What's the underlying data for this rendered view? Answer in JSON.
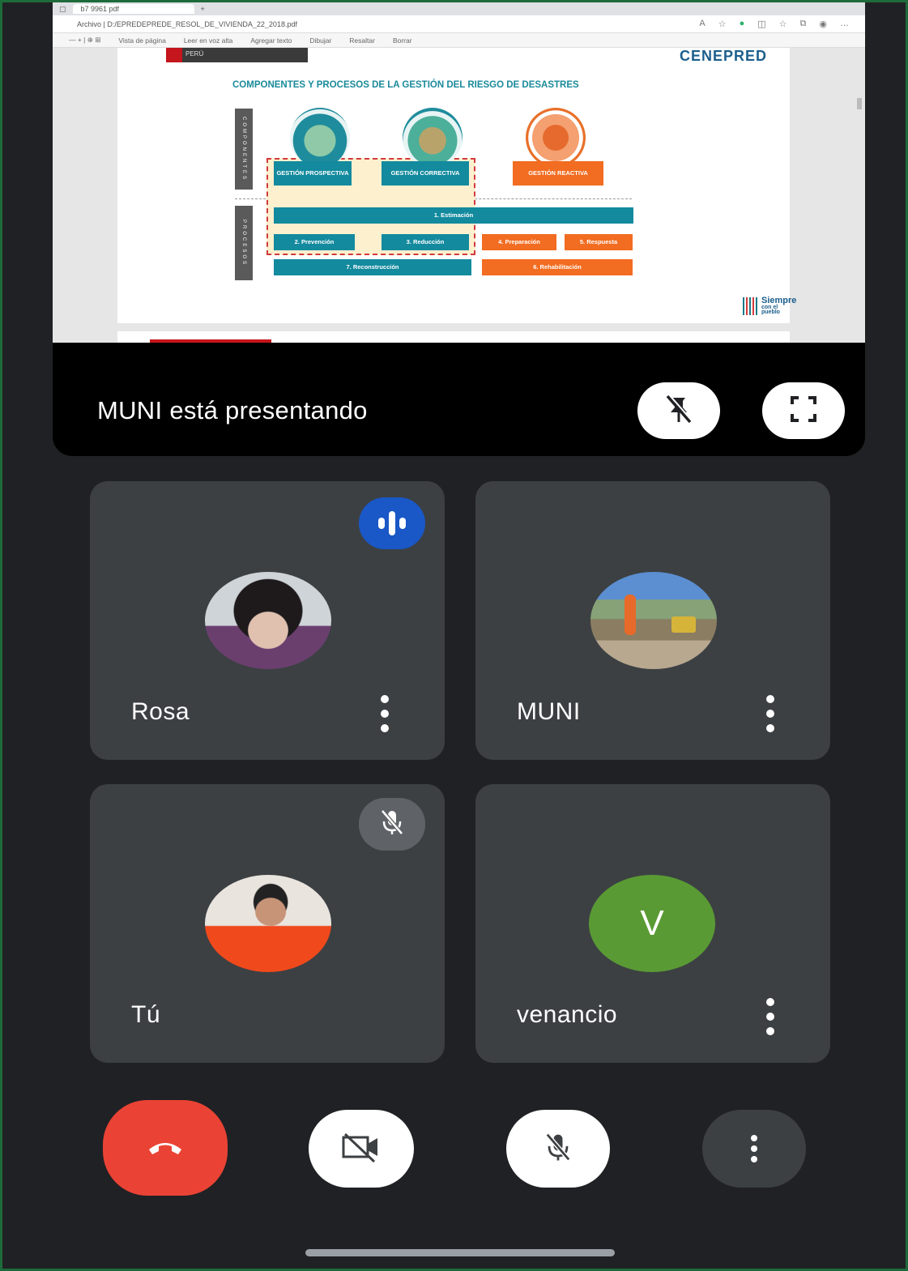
{
  "browser": {
    "tab_title": "b7 9961 pdf",
    "url": "Archivo | D:/EPREDEPREDE_RESOL_DE_VIVIENDA_22_2018.pdf",
    "pdf_toolbar": [
      "— + | ⊕ ⊞",
      "Vista de página",
      "Leer en voz alta",
      "Agregar texto",
      "Dibujar",
      "Resaltar",
      "Borrar"
    ]
  },
  "slide": {
    "title": "COMPONENTES Y PROCESOS DE LA GESTIÓN DEL RIESGO DE DESASTRES",
    "logo_text": "CENEPRED",
    "components_label": "COMPONENTES",
    "processes_label": "PROCESOS",
    "components": [
      "GESTIÓN PROSPECTIVA",
      "GESTIÓN CORRECTIVA",
      "GESTIÓN REACTIVA"
    ],
    "processes": {
      "estimacion": "1. Estimación",
      "prevencion": "2. Prevención",
      "reduccion": "3. Reducción",
      "preparacion": "4. Preparación",
      "respuesta": "5. Respuesta",
      "rehabilitacion": "6. Rehabilitación",
      "reconstruccion": "7. Reconstrucción"
    },
    "footer_brand": "Siempre",
    "footer_brand_sub": "con el pueblo",
    "colors": {
      "teal": "#138a9e",
      "orange": "#f26c21",
      "dashed": "#d23a3a"
    }
  },
  "presentation": {
    "presenting_text": "MUNI está presentando",
    "unpin_icon": "unpin-icon",
    "fullscreen_icon": "fullscreen-icon"
  },
  "participants": [
    {
      "name": "Rosa",
      "status_icon": "speaking-icon"
    },
    {
      "name": "MUNI"
    },
    {
      "name": "Tú",
      "status_icon": "mic-off-icon"
    },
    {
      "name": "venancio",
      "initial": "V"
    }
  ],
  "controls": {
    "end_call_icon": "end-call-icon",
    "camera_icon": "camera-off-icon",
    "mic_icon": "mic-off-icon",
    "more_icon": "more-vert-icon",
    "end_call_color": "#ea4335"
  }
}
